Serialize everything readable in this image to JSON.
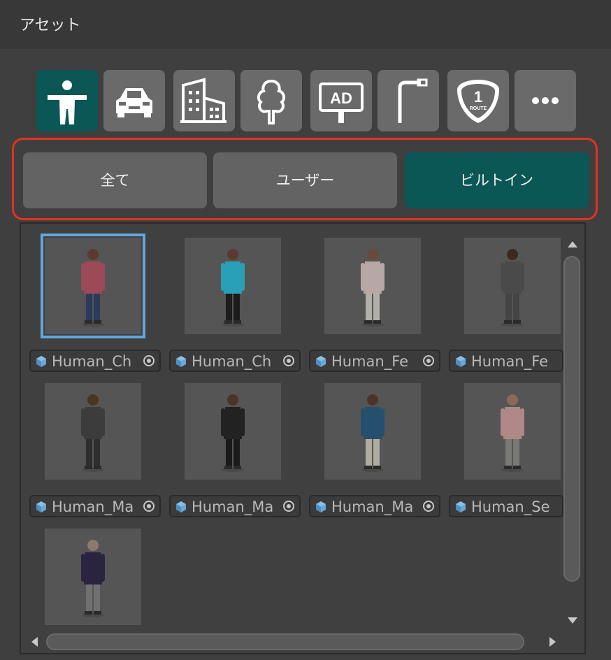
{
  "window": {
    "title": "アセット"
  },
  "categories": [
    {
      "name": "human",
      "icon": "person-icon",
      "selected": true
    },
    {
      "name": "vehicle",
      "icon": "car-icon"
    },
    {
      "name": "building",
      "icon": "building-icon"
    },
    {
      "name": "plant",
      "icon": "tree-icon"
    },
    {
      "name": "advertisement",
      "icon": "ad-billboard-icon",
      "icon_text": "AD"
    },
    {
      "name": "streetlight",
      "icon": "streetlight-icon"
    },
    {
      "name": "route-sign",
      "icon": "route-sign-icon",
      "icon_text": "1",
      "icon_subtext": "ROUTE"
    },
    {
      "name": "more",
      "icon": "more-dots-icon"
    }
  ],
  "subtabs": [
    {
      "label": "全て"
    },
    {
      "label": "ユーザー"
    },
    {
      "label": "ビルトイン",
      "selected": true
    }
  ],
  "assets": [
    {
      "name": "Human_Ch",
      "shirt": "#9c4a58",
      "lower": "#2c3a5c",
      "skin": "#5a3a2e",
      "selected": true
    },
    {
      "name": "Human_Ch",
      "shirt": "#2aa0b8",
      "lower": "#1c1c1c",
      "skin": "#5a3a2e"
    },
    {
      "name": "Human_Fe",
      "shirt": "#b8a8a4",
      "lower": "#b0b0a8",
      "skin": "#6a4a3a"
    },
    {
      "name": "Human_Fe",
      "shirt": "#4a4a4a",
      "lower": "#444444",
      "skin": "#3a2a22"
    },
    {
      "name": "Human_Ma",
      "shirt": "#3c3c3c",
      "lower": "#2e2e2e",
      "skin": "#4a3428"
    },
    {
      "name": "Human_Ma",
      "shirt": "#222222",
      "lower": "#1a1a1a",
      "skin": "#4a3428"
    },
    {
      "name": "Human_Ma",
      "shirt": "#24506e",
      "lower": "#b0aca0",
      "skin": "#4a3428"
    },
    {
      "name": "Human_Se",
      "shirt": "#b08888",
      "lower": "#7a7a74",
      "skin": "#8a6a5a"
    },
    {
      "name": "",
      "shirt": "#2a2440",
      "lower": "#707070",
      "skin": "#8a7a70"
    }
  ],
  "colors": {
    "accent": "#0b5756",
    "highlight": "#e5321e",
    "selection": "#60a8e0"
  }
}
